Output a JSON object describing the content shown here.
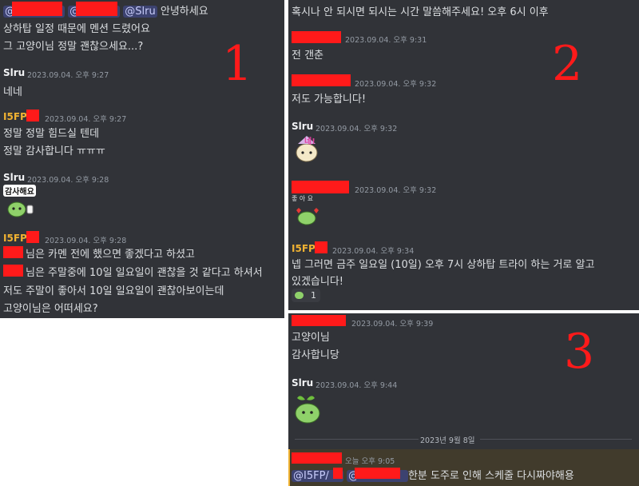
{
  "panel1": {
    "mention_prefix_1": "@",
    "mention_prefix_2": "@",
    "mention_slru": "@Slru",
    "mention_suffix": "안녕하세요",
    "line2": "상하탑 일정 때문에 멘션 드렸어요",
    "line3": "그 고양이님 정말 괜찮으세요...?",
    "msg_slru_1": {
      "author": "Slru",
      "time": "2023.09.04. 오후 9:27",
      "text": "네네"
    },
    "msg_i5fp_1": {
      "author": "I5FP/",
      "time": "2023.09.04. 오후 9:27",
      "line1": "정말 정말 힘드실 텐데",
      "line2": "정말 감사합니다 ㅠㅠㅠ"
    },
    "msg_slru_2": {
      "author": "Slru",
      "time": "2023.09.04. 오후 9:28",
      "sticker_text": "감사해요"
    },
    "msg_i5fp_2": {
      "author": "I5FP/",
      "time": "2023.09.04. 오후 9:28",
      "line1": "님은 카멘 전에 했으면 좋겠다고 하셨고",
      "line2": "님은 주말중에 10일 일요일이 괜찮을 것 같다고 하셔서",
      "line3": "저도 주말이 좋아서 10일 일요일이 괜찮아보이는데",
      "line4": "고양이님은 어떠세요?"
    },
    "annotation": "1"
  },
  "panel2": {
    "top_line": "혹시나 안 되시면 되시는 시간 말씀해주세요! 오후 6시 이후",
    "msg_a": {
      "time": "2023.09.04. 오후 9:31",
      "text": "전 갠춘"
    },
    "msg_b": {
      "time": "2023.09.04. 오후 9:32",
      "text": "저도 가능합니다!"
    },
    "msg_slru": {
      "author": "Slru",
      "time": "2023.09.04. 오후 9:32",
      "sticker_text": "네!"
    },
    "msg_c": {
      "time": "2023.09.04. 오후 9:32",
      "sticker_text": "좋 아 요"
    },
    "msg_i5fp": {
      "author": "I5FP/",
      "time": "2023.09.04. 오후 9:34",
      "line1": "넵 그러면 금주 일요일 (10일) 오후 7시 상하탑 트라이 하는 거로 알고",
      "line2": "있겠습니다!",
      "reaction_count": "1"
    },
    "annotation": "2"
  },
  "panel3": {
    "msg_a": {
      "time": "2023.09.04. 오후 9:39",
      "line1": "고양이님",
      "line2": "감사합니당"
    },
    "msg_slru": {
      "author": "Slru",
      "time": "2023.09.04. 오후 9:44"
    },
    "date_divider": "2023년 9월 8일",
    "msg_b": {
      "time": "오늘 오후 9:05",
      "mention_1": "@I5FP/",
      "mention_2": "@",
      "text": "한분 도주로 인해 스케줄 다시짜야해용"
    },
    "annotation": "3"
  },
  "colors": {
    "background": "#313338",
    "highlight": "#413b2c",
    "redaction": "#ff1a1a",
    "gold_name": "#f0b232",
    "mention_bg": "#3c4270"
  }
}
